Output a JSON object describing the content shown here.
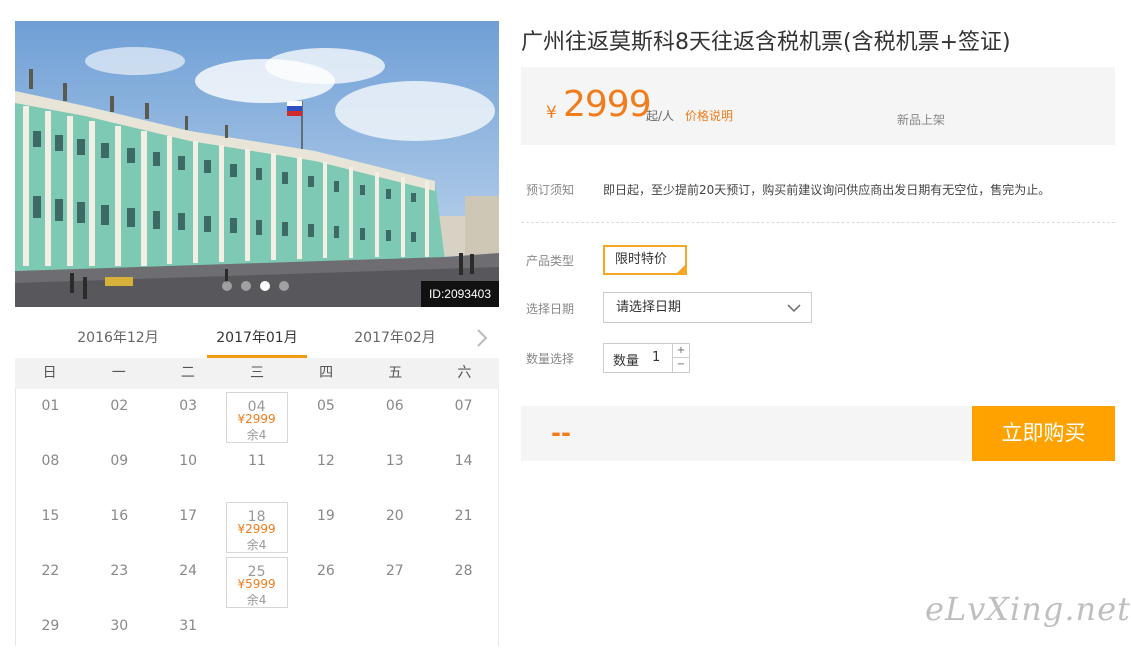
{
  "hero": {
    "id_badge": "ID:2093403",
    "slides": 4,
    "active_slide": 3
  },
  "calendar": {
    "months": [
      "2016年12月",
      "2017年01月",
      "2017年02月"
    ],
    "active_month": 1,
    "weekdays": [
      "日",
      "一",
      "二",
      "三",
      "四",
      "五",
      "六"
    ],
    "weeks": [
      [
        {
          "day": "01"
        },
        {
          "day": "02"
        },
        {
          "day": "03"
        },
        {
          "day": "04",
          "price": "¥2999",
          "left": "余4"
        },
        {
          "day": "05"
        },
        {
          "day": "06"
        },
        {
          "day": "07"
        }
      ],
      [
        {
          "day": "08"
        },
        {
          "day": "09"
        },
        {
          "day": "10"
        },
        {
          "day": "11"
        },
        {
          "day": "12"
        },
        {
          "day": "13"
        },
        {
          "day": "14"
        }
      ],
      [
        {
          "day": "15"
        },
        {
          "day": "16"
        },
        {
          "day": "17"
        },
        {
          "day": "18",
          "price": "¥2999",
          "left": "余4"
        },
        {
          "day": "19"
        },
        {
          "day": "20"
        },
        {
          "day": "21"
        }
      ],
      [
        {
          "day": "22"
        },
        {
          "day": "23"
        },
        {
          "day": "24"
        },
        {
          "day": "25",
          "price": "¥5999",
          "left": "余4"
        },
        {
          "day": "26"
        },
        {
          "day": "27"
        },
        {
          "day": "28"
        }
      ],
      [
        {
          "day": "29"
        },
        {
          "day": "30"
        },
        {
          "day": "31"
        },
        {
          "day": ""
        },
        {
          "day": ""
        },
        {
          "day": ""
        },
        {
          "day": ""
        }
      ]
    ]
  },
  "product": {
    "title": "广州往返莫斯科8天往返含税机票(含税机票+签证)",
    "currency": "¥",
    "price": "2999",
    "price_unit": "起/人",
    "price_note": "价格说明",
    "new_tag": "新品上架",
    "notice_label": "预订须知",
    "notice_text": "即日起，至少提前20天预订，购买前建议询问供应商出发日期有无空位，售完为止。",
    "type_label": "产品类型",
    "type_value": "限时特价",
    "date_label": "选择日期",
    "date_placeholder": "请选择日期",
    "qty_section_label": "数量选择",
    "qty_label": "数量",
    "qty_value": "1",
    "qty_up": "+",
    "qty_down": "−",
    "total": "--",
    "buy_label": "立即购买"
  },
  "watermark": "eLvXing.net",
  "colors": {
    "accent": "#f07c1b",
    "buy_button": "#ffa200",
    "panel_bg": "#f5f5f5"
  }
}
